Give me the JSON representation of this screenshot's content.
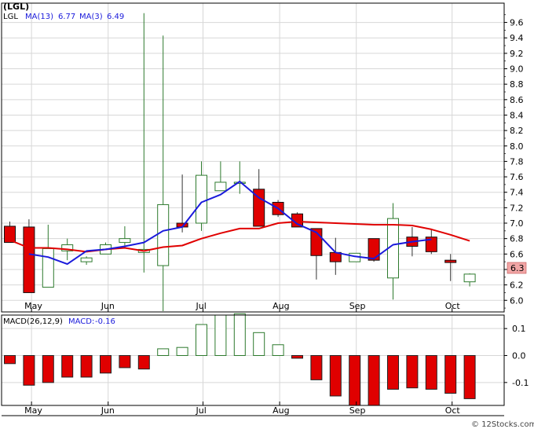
{
  "chart_data": {
    "type": "candlestick",
    "price": {
      "title": "(LGL)",
      "legend": [
        {
          "label": "LGL",
          "color": "#000000"
        },
        {
          "label": "MA(13)",
          "value": "6.77",
          "color": "#dd0000"
        },
        {
          "label": "MA(3)",
          "value": "6.49",
          "color": "#1a1adb"
        }
      ],
      "ylim": [
        5.85,
        9.85
      ],
      "yticks": [
        "6.0",
        "6.2",
        "6.4",
        "6.6",
        "6.8",
        "7.0",
        "7.2",
        "7.4",
        "7.6",
        "7.8",
        "8.0",
        "8.2",
        "8.4",
        "8.6",
        "8.8",
        "9.0",
        "9.2",
        "9.4",
        "9.6"
      ],
      "last_price": "6.3",
      "x_labels": [
        "May",
        "Jun",
        "Jul",
        "Aug",
        "Sep",
        "Oct"
      ],
      "candles": [
        {
          "o": 6.96,
          "h": 7.02,
          "l": 6.75,
          "c": 6.75
        },
        {
          "o": 6.95,
          "h": 7.05,
          "l": 6.1,
          "c": 6.1
        },
        {
          "o": 6.17,
          "h": 6.98,
          "l": 6.17,
          "c": 6.67
        },
        {
          "o": 6.64,
          "h": 6.8,
          "l": 6.52,
          "c": 6.72
        },
        {
          "o": 6.5,
          "h": 6.57,
          "l": 6.46,
          "c": 6.55
        },
        {
          "o": 6.6,
          "h": 6.75,
          "l": 6.6,
          "c": 6.72
        },
        {
          "o": 6.75,
          "h": 6.96,
          "l": 6.7,
          "c": 6.8
        },
        {
          "o": 6.62,
          "h": 9.72,
          "l": 6.36,
          "c": 6.66
        },
        {
          "o": 6.45,
          "h": 9.43,
          "l": 5.86,
          "c": 7.24
        },
        {
          "o": 7.0,
          "h": 7.63,
          "l": 6.88,
          "c": 6.95
        },
        {
          "o": 7.0,
          "h": 7.8,
          "l": 6.9,
          "c": 7.62
        },
        {
          "o": 7.42,
          "h": 7.8,
          "l": 7.42,
          "c": 7.53
        },
        {
          "o": 7.53,
          "h": 7.8,
          "l": 7.38,
          "c": 7.53
        },
        {
          "o": 7.44,
          "h": 7.7,
          "l": 6.96,
          "c": 6.96
        },
        {
          "o": 7.27,
          "h": 7.3,
          "l": 7.08,
          "c": 7.11
        },
        {
          "o": 7.12,
          "h": 7.14,
          "l": 6.95,
          "c": 6.95
        },
        {
          "o": 6.93,
          "h": 6.93,
          "l": 6.27,
          "c": 6.58
        },
        {
          "o": 6.62,
          "h": 6.81,
          "l": 6.33,
          "c": 6.5
        },
        {
          "o": 6.5,
          "h": 6.61,
          "l": 6.5,
          "c": 6.61
        },
        {
          "o": 6.8,
          "h": 6.8,
          "l": 6.5,
          "c": 6.52
        },
        {
          "o": 6.29,
          "h": 7.26,
          "l": 6.01,
          "c": 7.06
        },
        {
          "o": 6.82,
          "h": 6.95,
          "l": 6.57,
          "c": 6.7
        },
        {
          "o": 6.82,
          "h": 6.92,
          "l": 6.6,
          "c": 6.63
        },
        {
          "o": 6.52,
          "h": 6.6,
          "l": 6.25,
          "c": 6.49
        },
        {
          "o": 6.24,
          "h": 6.35,
          "l": 6.18,
          "c": 6.34
        }
      ],
      "ma13": [
        6.78,
        6.68,
        6.68,
        6.66,
        6.63,
        6.66,
        6.68,
        6.64,
        6.69,
        6.71,
        6.8,
        6.87,
        6.93,
        6.93,
        7.0,
        7.02,
        7.01,
        7.0,
        6.99,
        6.98,
        6.98,
        6.97,
        6.92,
        6.85,
        6.77
      ],
      "ma3": [
        null,
        6.6,
        6.56,
        6.47,
        6.64,
        6.66,
        6.7,
        6.75,
        6.9,
        6.95,
        7.27,
        7.37,
        7.54,
        7.33,
        7.19,
        6.99,
        6.88,
        6.62,
        6.57,
        6.54,
        6.72,
        6.76,
        6.79,
        null,
        null
      ]
    },
    "macd": {
      "legend": [
        {
          "label": "MACD(26,12,9)",
          "color": "#000000"
        },
        {
          "label": "MACD:",
          "value": "-0.16",
          "color": "#1a1adb"
        }
      ],
      "ylim": [
        -0.185,
        0.15
      ],
      "yticks": [
        "0.1",
        "0.0",
        "-0.1"
      ],
      "histogram": [
        -0.03,
        -0.11,
        -0.1,
        -0.08,
        -0.08,
        -0.065,
        -0.045,
        -0.05,
        0.025,
        0.03,
        0.115,
        0.15,
        0.155,
        0.085,
        0.04,
        -0.01,
        -0.09,
        -0.15,
        -0.185,
        -0.185,
        -0.125,
        -0.12,
        -0.125,
        -0.14,
        -0.16
      ]
    },
    "watermark": "© 12Stocks.com"
  }
}
